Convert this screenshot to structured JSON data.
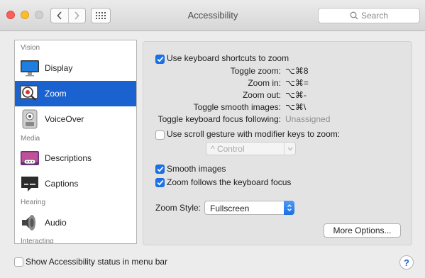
{
  "window": {
    "title": "Accessibility",
    "search_placeholder": "Search"
  },
  "sidebar": {
    "sections": [
      {
        "header": "Vision"
      },
      {
        "header": "Media"
      },
      {
        "header": "Hearing"
      },
      {
        "header": "Interacting"
      }
    ],
    "items": [
      {
        "label": "Display",
        "icon": "display-icon"
      },
      {
        "label": "Zoom",
        "icon": "zoom-icon",
        "selected": true
      },
      {
        "label": "VoiceOver",
        "icon": "voiceover-icon"
      },
      {
        "label": "Descriptions",
        "icon": "descriptions-icon"
      },
      {
        "label": "Captions",
        "icon": "captions-icon"
      },
      {
        "label": "Audio",
        "icon": "audio-icon"
      }
    ]
  },
  "zoom": {
    "keyboard_shortcuts": {
      "label": "Use keyboard shortcuts to zoom",
      "checked": true
    },
    "shortcuts": [
      {
        "label": "Toggle zoom:",
        "value": "⌥⌘8"
      },
      {
        "label": "Zoom in:",
        "value": "⌥⌘="
      },
      {
        "label": "Zoom out:",
        "value": "⌥⌘-"
      },
      {
        "label": "Toggle smooth images:",
        "value": "⌥⌘\\"
      },
      {
        "label": "Toggle keyboard focus following:",
        "value": "Unassigned"
      }
    ],
    "scroll_gesture": {
      "label": "Use scroll gesture with modifier keys to zoom:",
      "checked": false
    },
    "modifier_popup": "^ Control",
    "smooth_images": {
      "label": "Smooth images",
      "checked": true
    },
    "follow_focus": {
      "label": "Zoom follows the keyboard focus",
      "checked": true
    },
    "zoom_style_label": "Zoom Style:",
    "zoom_style_value": "Fullscreen",
    "more_options": "More Options..."
  },
  "footer": {
    "show_status_label": "Show Accessibility status in menu bar",
    "show_status_checked": false,
    "help": "?"
  },
  "colors": {
    "selection": "#1a62d0",
    "checkbox_on": "#1b72e8"
  }
}
